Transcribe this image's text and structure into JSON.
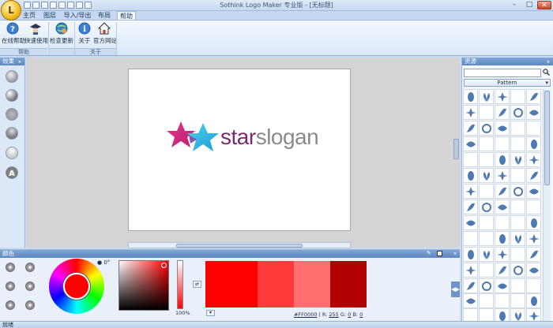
{
  "window": {
    "title": "Sothink Logo Maker 专业版 - [无标题]",
    "controls": {
      "minimize": "–",
      "maximize": "□",
      "close": "✕"
    }
  },
  "app_button": {
    "glyph": "L"
  },
  "tabs": [
    {
      "label": "主页"
    },
    {
      "label": "图层"
    },
    {
      "label": "导入/导出"
    },
    {
      "label": "布局"
    },
    {
      "label": "帮助"
    }
  ],
  "ribbon": {
    "help_group": {
      "label": "帮助",
      "buttons": [
        {
          "label": "在线帮助",
          "icon": "question-icon"
        },
        {
          "label": "快速使用",
          "icon": "graduate-icon"
        }
      ]
    },
    "update_group": {
      "buttons": [
        {
          "label": "检查更新",
          "icon": "globe-icon"
        }
      ]
    },
    "about_group": {
      "label": "关于",
      "buttons": [
        {
          "label": "关于",
          "icon": "info-icon"
        },
        {
          "label": "官方网站",
          "icon": "home-icon"
        }
      ]
    }
  },
  "effects_panel": {
    "title": "效果",
    "pin": "⌅"
  },
  "canvas": {
    "logo": {
      "word_a": "star",
      "word_b": "slogan",
      "color_a": "#7a2a6e",
      "color_b": "#8a8a8a"
    }
  },
  "resources_panel": {
    "title": "资源",
    "pin": "⌅",
    "search_placeholder": "",
    "dropdown_value": "Pattern",
    "shape_color": "#4d7ab3"
  },
  "color_panel": {
    "title": "颜色",
    "angle_label": "0°",
    "alpha_value": "100",
    "alpha_unit": "%",
    "swatches": [
      "#ff0000",
      "#ff3b3b",
      "#ff6f6f",
      "#b00000"
    ],
    "hex_value": "#FF0000",
    "r_label": "R:",
    "r_value": "255",
    "g_label": "G:",
    "g_value": "0",
    "b_label": "B:",
    "b_value": "0"
  },
  "status_bar": {
    "text": "就绪"
  }
}
